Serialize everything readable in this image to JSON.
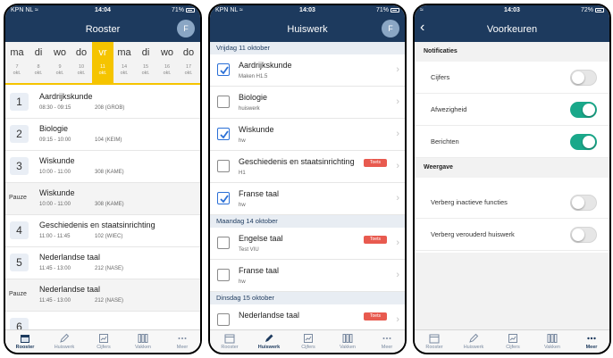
{
  "colors": {
    "header": "#1d3a5e",
    "accent_yellow": "#f5c400",
    "toggle_on": "#1aa88a",
    "toets_badge": "#e85a4f"
  },
  "tabs": [
    {
      "label": "Rooster",
      "icon": "calendar-icon"
    },
    {
      "label": "Huiswerk",
      "icon": "pencil-icon"
    },
    {
      "label": "Cijfers",
      "icon": "chart-icon"
    },
    {
      "label": "Vakken",
      "icon": "books-icon"
    },
    {
      "label": "Meer",
      "icon": "more-icon"
    }
  ],
  "rooster": {
    "status": {
      "carrier": "KPN NL",
      "time": "14:04",
      "battery": "71%"
    },
    "title": "Rooster",
    "avatar": "F",
    "days": [
      {
        "name": "ma",
        "num": "7",
        "month": "okt."
      },
      {
        "name": "di",
        "num": "8",
        "month": "okt."
      },
      {
        "name": "wo",
        "num": "9",
        "month": "okt."
      },
      {
        "name": "do",
        "num": "10",
        "month": "okt."
      },
      {
        "name": "vr",
        "num": "11",
        "month": "okt."
      },
      {
        "name": "ma",
        "num": "14",
        "month": "okt."
      },
      {
        "name": "di",
        "num": "15",
        "month": "okt."
      },
      {
        "name": "wo",
        "num": "16",
        "month": "okt."
      },
      {
        "name": "do",
        "num": "17",
        "month": "okt."
      }
    ],
    "lessons": [
      {
        "num": "1",
        "subject": "Aardrijkskunde",
        "time": "08:30 - 09:15",
        "room": "208 (GROB)"
      },
      {
        "num": "2",
        "subject": "Biologie",
        "time": "09:15 - 10:00",
        "room": "104 (KEIM)"
      },
      {
        "num": "3",
        "subject": "Wiskunde",
        "time": "10:00 - 11:00",
        "room": "308 (KAME)"
      },
      {
        "num": "Pauze",
        "subject": "Wiskunde",
        "time": "10:00 - 11:00",
        "room": "308 (KAME)"
      },
      {
        "num": "4",
        "subject": "Geschiedenis en staatsinrichting",
        "time": "11:00 - 11:45",
        "room": "102 (WIEC)"
      },
      {
        "num": "5",
        "subject": "Nederlandse taal",
        "time": "11:45 - 13:00",
        "room": "212 (NASE)"
      },
      {
        "num": "Pauze",
        "subject": "Nederlandse taal",
        "time": "11:45 - 13:00",
        "room": "212 (NASE)"
      },
      {
        "num": "6",
        "subject": "",
        "time": "",
        "room": ""
      }
    ]
  },
  "huiswerk": {
    "status": {
      "carrier": "KPN NL",
      "time": "14:03",
      "battery": "71%"
    },
    "title": "Huiswerk",
    "avatar": "F",
    "sections": [
      {
        "header": "Vrijdag 11 oktober"
      },
      {
        "header": "Maandag 14 oktober"
      },
      {
        "header": "Dinsdag 15 oktober"
      }
    ],
    "items": [
      {
        "title": "Aardrijkskunde",
        "sub": "Maken H1.5",
        "checked": true,
        "badge": ""
      },
      {
        "title": "Biologie",
        "sub": "huiswerk",
        "checked": false,
        "badge": ""
      },
      {
        "title": "Wiskunde",
        "sub": "hw",
        "checked": true,
        "badge": ""
      },
      {
        "title": "Geschiedenis en staatsinrichting",
        "sub": "H1",
        "checked": false,
        "badge": "Toets"
      },
      {
        "title": "Franse taal",
        "sub": "hw",
        "checked": true,
        "badge": ""
      },
      {
        "title": "Engelse taal",
        "sub": "Test VIU",
        "checked": false,
        "badge": "Toets"
      },
      {
        "title": "Franse taal",
        "sub": "hw",
        "checked": false,
        "badge": ""
      },
      {
        "title": "Nederlandse taal",
        "sub": "",
        "checked": false,
        "badge": "Toets"
      }
    ]
  },
  "voorkeuren": {
    "status": {
      "carrier": "",
      "time": "14:03",
      "battery": "72%"
    },
    "title": "Voorkeuren",
    "groups": [
      {
        "label": "Notificaties"
      },
      {
        "label": "Weergave"
      }
    ],
    "rows": [
      {
        "label": "Cijfers",
        "on": false
      },
      {
        "label": "Afwezigheid",
        "on": true
      },
      {
        "label": "Berichten",
        "on": true
      },
      {
        "label": "Verberg inactieve functies",
        "on": false
      },
      {
        "label": "Verberg verouderd huiswerk",
        "on": false
      }
    ]
  }
}
